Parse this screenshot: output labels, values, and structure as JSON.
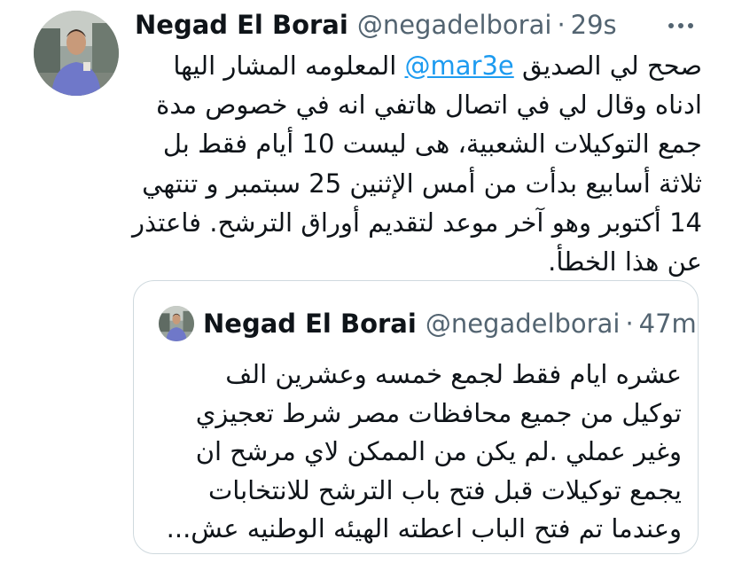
{
  "tweet": {
    "author_name": "Negad El Borai",
    "author_handle": "@negadelborai",
    "separator": "·",
    "timestamp": "29s",
    "more_icon": "more-horizontal-icon",
    "text_start": "صحح لي الصديق ",
    "mention": "@mar3e",
    "text_rest": " المعلومه المشار اليها\nادناه وقال لي في اتصال هاتفي انه في خصوص مدة\nجمع التوكيلات الشعبية، هى ليست 10 أيام فقط بل\nثلاثة أسابيع بدأت من أمس الإثنين 25 سبتمبر و تنتهي\n14 أكتوبر وهو آخر موعد لتقديم أوراق الترشح. فاعتذر\nعن هذا الخطأ."
  },
  "quoted_tweet": {
    "author_name": "Negad El Borai",
    "author_handle": "@negadelborai",
    "separator": "·",
    "timestamp": "47m",
    "text": "عشره ايام فقط لجمع خمسه وعشرين الف\nتوكيل من جميع محافظات مصر شرط تعجيزي\nوغير عملي .لم يكن من الممكن لاي مرشح ان\nيجمع توكيلات قبل فتح باب الترشح للانتخابات\nوعندما تم فتح الباب اعطته الهيئه الوطنيه عش..."
  },
  "colors": {
    "text": "#0f1419",
    "secondary": "#536471",
    "link": "#1d9bf0",
    "border": "#cfd9de"
  }
}
